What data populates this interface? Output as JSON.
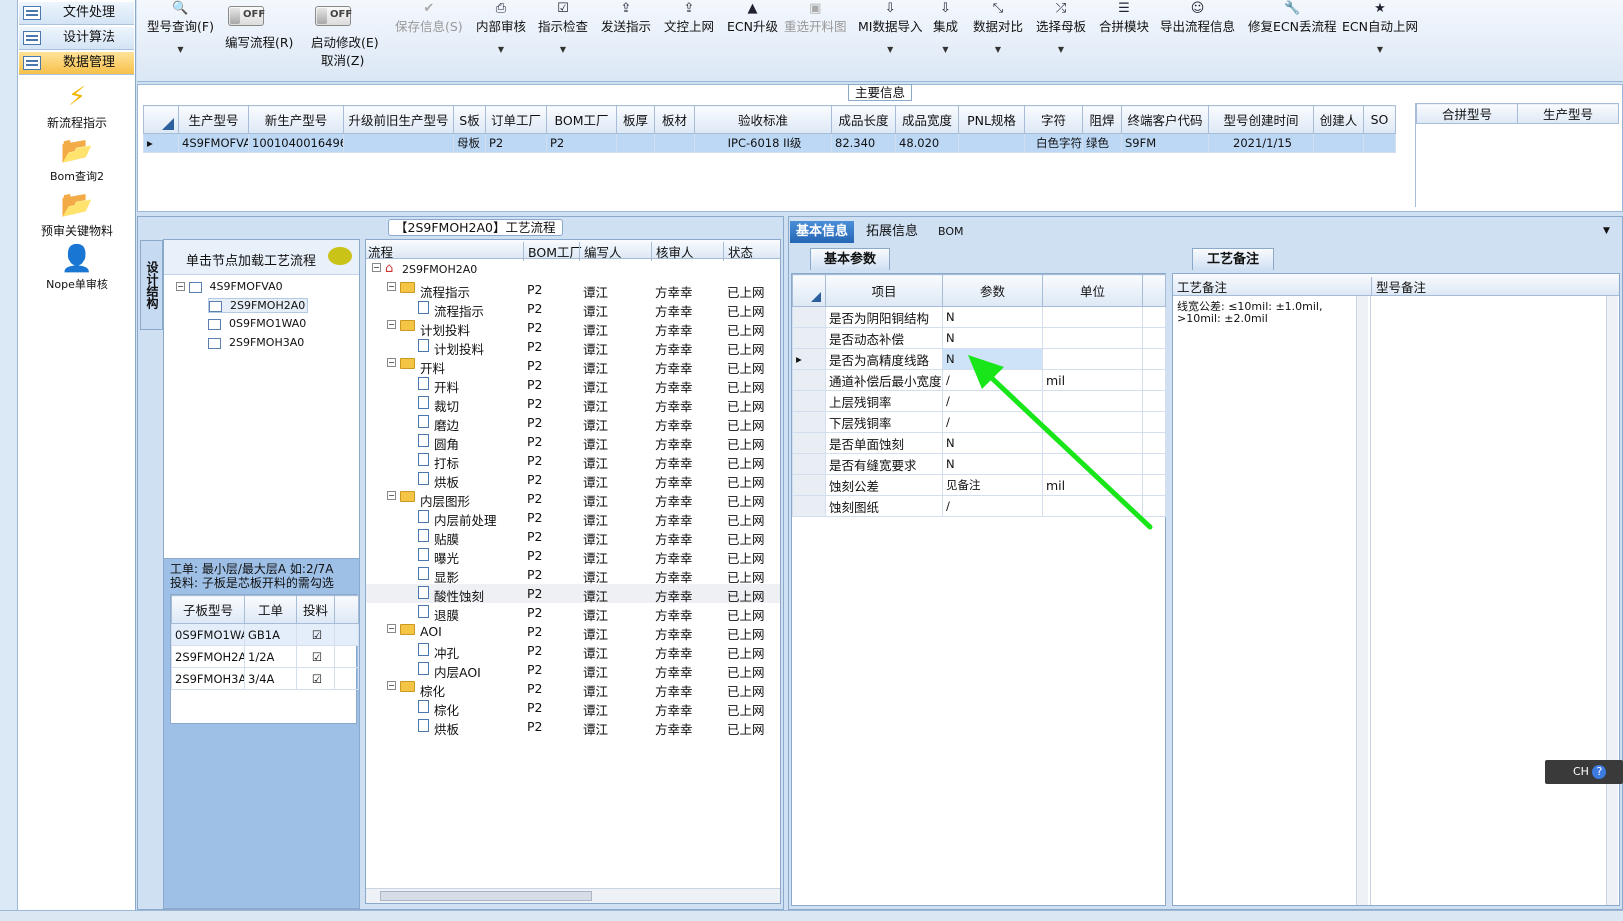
{
  "nav": {
    "items": [
      {
        "label": "文件处理"
      },
      {
        "label": "设计算法"
      },
      {
        "label": "数据管理"
      }
    ],
    "tools": [
      {
        "label": "新流程指示"
      },
      {
        "label": "Bom查询2"
      },
      {
        "label": "预审关键物料"
      },
      {
        "label": "Nope单审核"
      }
    ]
  },
  "toolbar": {
    "type_query": "型号查询(F)",
    "write_flow": "编写流程(R)",
    "enable_modify": "启动修改(E)",
    "cancel": "取消(Z)",
    "toggle_off": "OFF",
    "save_info": "保存信息(S)",
    "internal_review": "内部审核",
    "indication_check": "指示检查",
    "send_indication": "发送指示",
    "doc_upload": "文控上网",
    "ecn_upgrade": "ECN升级",
    "reselect_cut": "重选开料图",
    "mi_import": "MI数据导入",
    "integrate": "集成",
    "data_compare": "数据对比",
    "select_mother": "选择母板",
    "merge_module": "合拼模块",
    "export_flow": "导出流程信息",
    "fix_ecn": "修复ECN丢流程",
    "ecn_auto": "ECN自动上网"
  },
  "main_info": {
    "title": "主要信息",
    "columns": [
      "生产型号",
      "新生产型号",
      "升级前旧生产型号",
      "S板",
      "订单工厂",
      "BOM工厂",
      "板厚",
      "板材",
      "验收标准",
      "成品长度",
      "成品宽度",
      "PNL规格",
      "字符",
      "阻焊",
      "终端客户代码",
      "型号创建时间",
      "创建人",
      "SO"
    ],
    "row": [
      "4S9FMOFVA0",
      "10010400164963",
      "",
      "母板",
      "P2",
      "P2",
      "",
      "",
      "IPC-6018 II级",
      "82.340",
      "48.020",
      "",
      "白色字符",
      "绿色",
      "S9FM",
      "2021/1/15",
      "",
      ""
    ],
    "merge_columns": [
      "合拼型号",
      "生产型号"
    ]
  },
  "flow_panel": {
    "title": "【2S9FMOH2A0】工艺流程",
    "vertical_tab": "设计结构",
    "tree_header": "单击节点加载工艺流程",
    "tree_root": "4S9FMOFVA0",
    "tree_children": [
      "2S9FMOH2A0",
      "0S9FMO1WA0",
      "2S9FMOH3A0"
    ],
    "hint_line1": "工单: 最小层/最大层A 如:2/7A",
    "hint_line2": "投料: 子板是芯板开料的需勾选",
    "sub_columns": [
      "子板型号",
      "工单",
      "投料"
    ],
    "sub_rows": [
      {
        "model": "0S9FMO1WA0",
        "order": "GB1A"
      },
      {
        "model": "2S9FMOH2A0",
        "order": "1/2A"
      },
      {
        "model": "2S9FMOH3A0",
        "order": "3/4A"
      }
    ],
    "flow_columns": [
      "流程",
      "BOM工厂",
      "编写人",
      "核审人",
      "状态"
    ],
    "flow_root": "2S9FMOH2A0",
    "flow_rows": [
      {
        "name": "流程指示",
        "folder": true,
        "bom": "P2",
        "writer": "谭江",
        "reviewer": "方幸幸",
        "status": "已上网"
      },
      {
        "name": "流程指示",
        "folder": false,
        "bom": "P2",
        "writer": "谭江",
        "reviewer": "方幸幸",
        "status": "已上网"
      },
      {
        "name": "计划投料",
        "folder": true,
        "bom": "P2",
        "writer": "谭江",
        "reviewer": "方幸幸",
        "status": "已上网"
      },
      {
        "name": "计划投料",
        "folder": false,
        "bom": "P2",
        "writer": "谭江",
        "reviewer": "方幸幸",
        "status": "已上网"
      },
      {
        "name": "开料",
        "folder": true,
        "bom": "P2",
        "writer": "谭江",
        "reviewer": "方幸幸",
        "status": "已上网"
      },
      {
        "name": "开料",
        "folder": false,
        "bom": "P2",
        "writer": "谭江",
        "reviewer": "方幸幸",
        "status": "已上网"
      },
      {
        "name": "裁切",
        "folder": false,
        "bom": "P2",
        "writer": "谭江",
        "reviewer": "方幸幸",
        "status": "已上网"
      },
      {
        "name": "磨边",
        "folder": false,
        "bom": "P2",
        "writer": "谭江",
        "reviewer": "方幸幸",
        "status": "已上网"
      },
      {
        "name": "圆角",
        "folder": false,
        "bom": "P2",
        "writer": "谭江",
        "reviewer": "方幸幸",
        "status": "已上网"
      },
      {
        "name": "打标",
        "folder": false,
        "bom": "P2",
        "writer": "谭江",
        "reviewer": "方幸幸",
        "status": "已上网"
      },
      {
        "name": "烘板",
        "folder": false,
        "bom": "P2",
        "writer": "谭江",
        "reviewer": "方幸幸",
        "status": "已上网"
      },
      {
        "name": "内层图形",
        "folder": true,
        "bom": "P2",
        "writer": "谭江",
        "reviewer": "方幸幸",
        "status": "已上网"
      },
      {
        "name": "内层前处理",
        "folder": false,
        "bom": "P2",
        "writer": "谭江",
        "reviewer": "方幸幸",
        "status": "已上网"
      },
      {
        "name": "贴膜",
        "folder": false,
        "bom": "P2",
        "writer": "谭江",
        "reviewer": "方幸幸",
        "status": "已上网"
      },
      {
        "name": "曝光",
        "folder": false,
        "bom": "P2",
        "writer": "谭江",
        "reviewer": "方幸幸",
        "status": "已上网"
      },
      {
        "name": "显影",
        "folder": false,
        "bom": "P2",
        "writer": "谭江",
        "reviewer": "方幸幸",
        "status": "已上网"
      },
      {
        "name": "酸性蚀刻",
        "folder": false,
        "bom": "P2",
        "writer": "谭江",
        "reviewer": "方幸幸",
        "status": "已上网"
      },
      {
        "name": "退膜",
        "folder": false,
        "bom": "P2",
        "writer": "谭江",
        "reviewer": "方幸幸",
        "status": "已上网"
      },
      {
        "name": "AOI",
        "folder": true,
        "bom": "P2",
        "writer": "谭江",
        "reviewer": "方幸幸",
        "status": "已上网"
      },
      {
        "name": "冲孔",
        "folder": false,
        "bom": "P2",
        "writer": "谭江",
        "reviewer": "方幸幸",
        "status": "已上网"
      },
      {
        "name": "内层AOI",
        "folder": false,
        "bom": "P2",
        "writer": "谭江",
        "reviewer": "方幸幸",
        "status": "已上网"
      },
      {
        "name": "棕化",
        "folder": true,
        "bom": "P2",
        "writer": "谭江",
        "reviewer": "方幸幸",
        "status": "已上网"
      },
      {
        "name": "棕化",
        "folder": false,
        "bom": "P2",
        "writer": "谭江",
        "reviewer": "方幸幸",
        "status": "已上网"
      },
      {
        "name": "烘板",
        "folder": false,
        "bom": "P2",
        "writer": "谭江",
        "reviewer": "方幸幸",
        "status": "已上网"
      }
    ]
  },
  "right": {
    "tabs": [
      "基本信息",
      "拓展信息",
      "BOM"
    ],
    "basic_header": "基本参数",
    "basic_columns": [
      "项目",
      "参数",
      "单位"
    ],
    "basic_rows": [
      {
        "item": "是否为阴阳铜结构",
        "param": "N",
        "unit": ""
      },
      {
        "item": "是否动态补偿",
        "param": "N",
        "unit": ""
      },
      {
        "item": "是否为高精度线路",
        "param": "N",
        "unit": ""
      },
      {
        "item": "通道补偿后最小宽度",
        "param": "/",
        "unit": "mil"
      },
      {
        "item": "上层残铜率",
        "param": "/",
        "unit": ""
      },
      {
        "item": "下层残铜率",
        "param": "/",
        "unit": ""
      },
      {
        "item": "是否单面蚀刻",
        "param": "N",
        "unit": ""
      },
      {
        "item": "是否有缝宽要求",
        "param": "N",
        "unit": ""
      },
      {
        "item": "蚀刻公差",
        "param": "见备注",
        "unit": "mil"
      },
      {
        "item": "蚀刻图纸",
        "param": "/",
        "unit": ""
      }
    ],
    "note_header": "工艺备注",
    "note_columns": [
      "工艺备注",
      "型号备注"
    ],
    "note_line1": "线宽公差: ≤10mil: ±1.0mil,",
    "note_line2": ">10mil: ±2.0mil"
  },
  "ime": {
    "label": "CH"
  }
}
